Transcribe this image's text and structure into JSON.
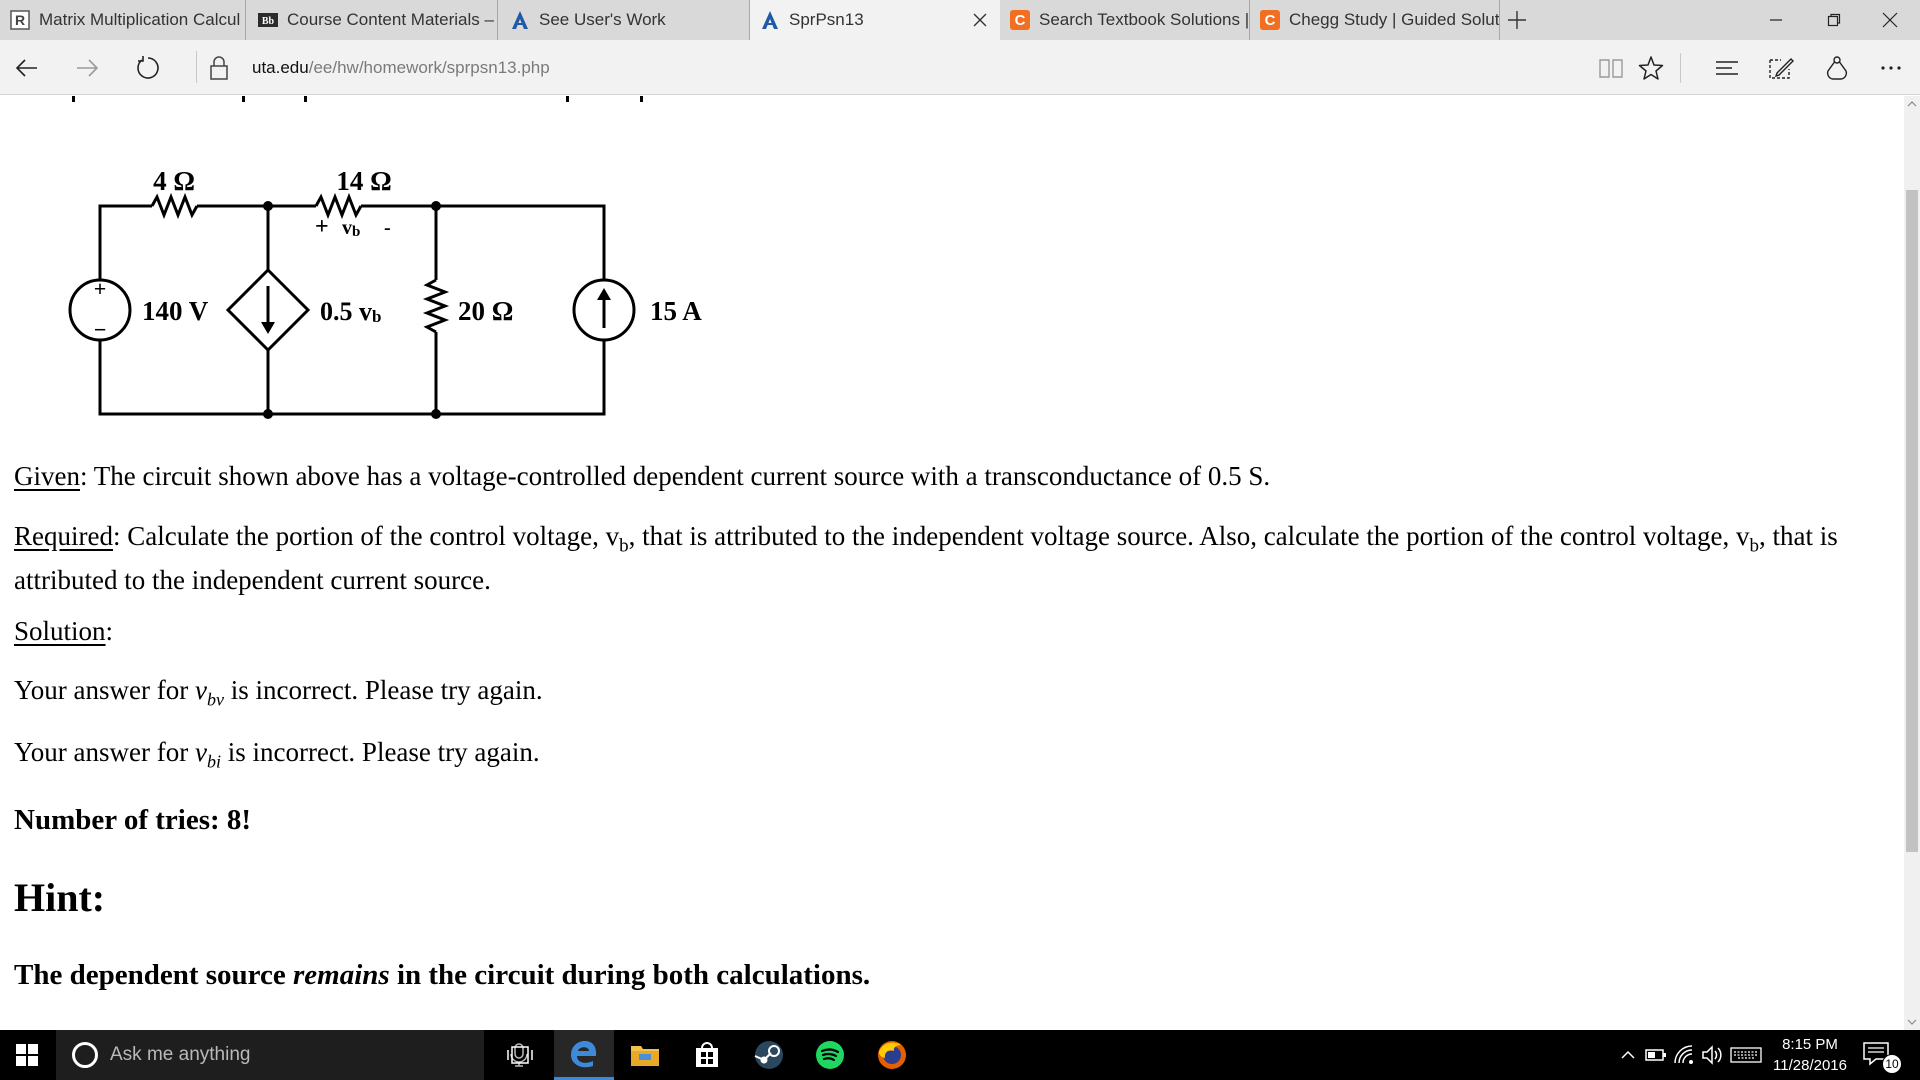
{
  "browser": {
    "tabs": [
      {
        "title": "Matrix Multiplication Calcul",
        "icon": "r-logo-icon",
        "active": false
      },
      {
        "title": "Course Content Materials –",
        "icon": "blackboard-icon",
        "active": false
      },
      {
        "title": "See User's Work",
        "icon": "a-logo-icon",
        "active": false
      },
      {
        "title": "SprPsn13",
        "icon": "a-logo-icon",
        "active": true
      },
      {
        "title": "Search Textbook Solutions |",
        "icon": "chegg-icon",
        "active": false
      },
      {
        "title": "Chegg Study | Guided Solut",
        "icon": "chegg-icon",
        "active": false
      }
    ],
    "address": {
      "domain": "uta.edu",
      "path": "/ee/hw/homework/sprpsn13.php"
    },
    "colors": {
      "chegg_orange": "#f26f21",
      "uta_blue": "#1e5aa8",
      "edge_blue": "#3f8ad8"
    }
  },
  "circuit": {
    "r1": "4 Ω",
    "r2": "14 Ω",
    "vb_plus": "+",
    "vb_name": "v",
    "vb_sub": "b",
    "vb_minus": "-",
    "vsource": "140 V",
    "vs_plus": "+",
    "vs_minus": "−",
    "dep_coeff": "0.5 v",
    "dep_sub": "b",
    "r3": "20 Ω",
    "isource": "15 A"
  },
  "content": {
    "given_label": "Given",
    "given_text": ": The circuit shown above has a voltage-controlled dependent current source with a transconductance of 0.5 S.",
    "required_label": "Required",
    "required_text_1": ": Calculate the portion of the control voltage, v",
    "required_sub_1": "b",
    "required_text_2": ", that is attributed to the independent voltage source. Also, calculate the portion of the control voltage, v",
    "required_sub_2": "b",
    "required_text_3": ", that is attributed to the independent current source.",
    "solution_label": "Solution",
    "solution_colon": ":",
    "answer1_pre": "Your answer for ",
    "answer1_var": "v",
    "answer1_sub": "bv",
    "answer1_post": " is incorrect. Please try again.",
    "answer2_pre": "Your answer for ",
    "answer2_var": "v",
    "answer2_sub": "bi",
    "answer2_post": " is incorrect. Please try again.",
    "tries": "Number of tries: 8!",
    "hint_heading": "Hint:",
    "hint_pre": "The dependent source ",
    "hint_em": "remains",
    "hint_post": " in the circuit during both calculations."
  },
  "taskbar": {
    "search_placeholder": "Ask me anything",
    "time": "8:15 PM",
    "date": "11/28/2016",
    "notification_count": "10"
  }
}
